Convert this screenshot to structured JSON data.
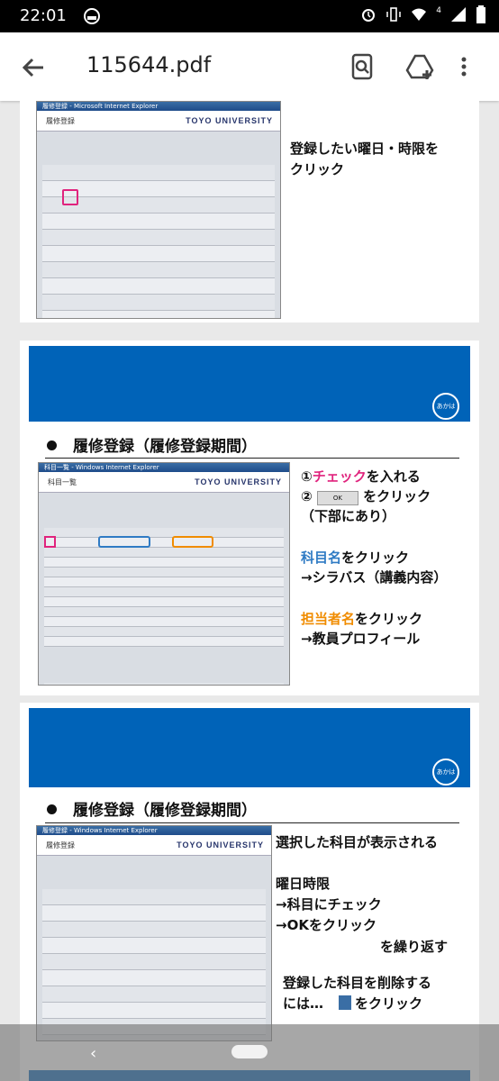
{
  "status_bar": {
    "time": "22:01",
    "battery_icon": "battery-icon",
    "signal_icon": "signal-icon",
    "wifi_icon": "wifi-icon",
    "alarm_icon": "alarm-icon",
    "vibrate_icon": "vibrate-icon",
    "network_badge": "4"
  },
  "toolbar": {
    "title": "115644.pdf",
    "back_icon": "arrow-back-icon",
    "search_icon": "search-document-icon",
    "drive_icon": "drive-add-icon",
    "menu_icon": "more-vert-icon"
  },
  "page1": {
    "window_title": "履修登録 - Microsoft Internet Explorer",
    "header_label": "履修登録",
    "university": "TOYO UNIVERSITY",
    "note": "登録したい曜日・時限を\nクリック"
  },
  "page2": {
    "badge": "あかはね",
    "heading": "履修登録（履修登録期間）",
    "window_title": "科目一覧 - Windows Internet Explorer",
    "header_label": "科目一覧",
    "university": "TOYO UNIVERSITY",
    "step1_prefix": "①",
    "step1_highlight": "チェック",
    "step1_suffix": "を入れる",
    "step2_prefix": "②",
    "step2_button": "OK",
    "step2_suffix": "をクリック",
    "step2_note": "（下部にあり）",
    "subject_highlight": "科目名",
    "subject_suffix": "をクリック",
    "subject_result": "→シラバス（講義内容）",
    "teacher_highlight": "担当者名",
    "teacher_suffix": "をクリック",
    "teacher_result": "→教員プロフィール",
    "accent_blue": "#2f7bc4",
    "accent_orange": "#f08c00",
    "accent_pink": "#e0237d"
  },
  "page3": {
    "badge": "あかはね",
    "heading": "履修登録（履修登録期間）",
    "window_title": "履修登録 - Windows Internet Explorer",
    "header_label": "履修登録",
    "university": "TOYO UNIVERSITY",
    "note_line1": "選択した科目が表示される",
    "note_line2": "曜日時限\n→科目にチェック\n→OKをクリック",
    "note_line3": "を繰り返す",
    "note_line4": "登録した科目を削除する\nには…",
    "note_line4_suffix": "をクリック"
  },
  "nav": {
    "back_label": "‹"
  }
}
